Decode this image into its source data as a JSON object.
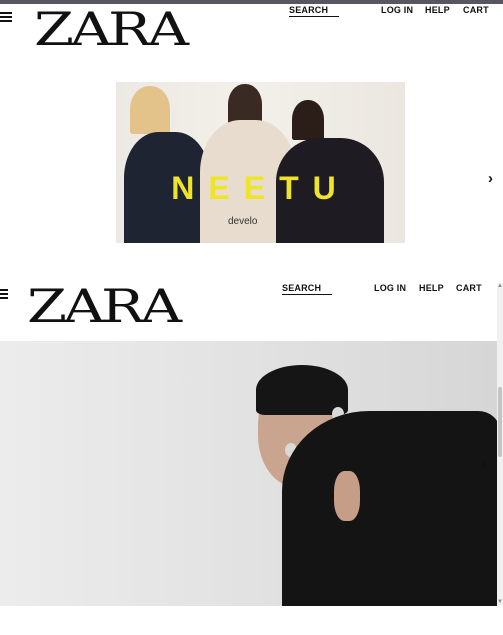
{
  "top_header": {
    "logo": "ZARA",
    "search_label": "SEARCH",
    "login_label": "LOG IN",
    "help_label": "HELP",
    "cart_label": "CART"
  },
  "hero_banner": {
    "title": "NEETU",
    "subtitle": "develo",
    "next_arrow": "›"
  },
  "second_header": {
    "logo": "ZARA",
    "search_label": "SEARCH",
    "login_label": "LOG IN",
    "help_label": "HELP",
    "cart_label": "CART"
  },
  "second_hero": {
    "next_arrow": "›"
  },
  "colors": {
    "hero_title": "#f0e42a",
    "top_strip": "#5b5560"
  },
  "icons": [
    "hamburger-menu-icon",
    "chevron-right-icon",
    "scroll-up-icon",
    "scroll-down-icon"
  ]
}
